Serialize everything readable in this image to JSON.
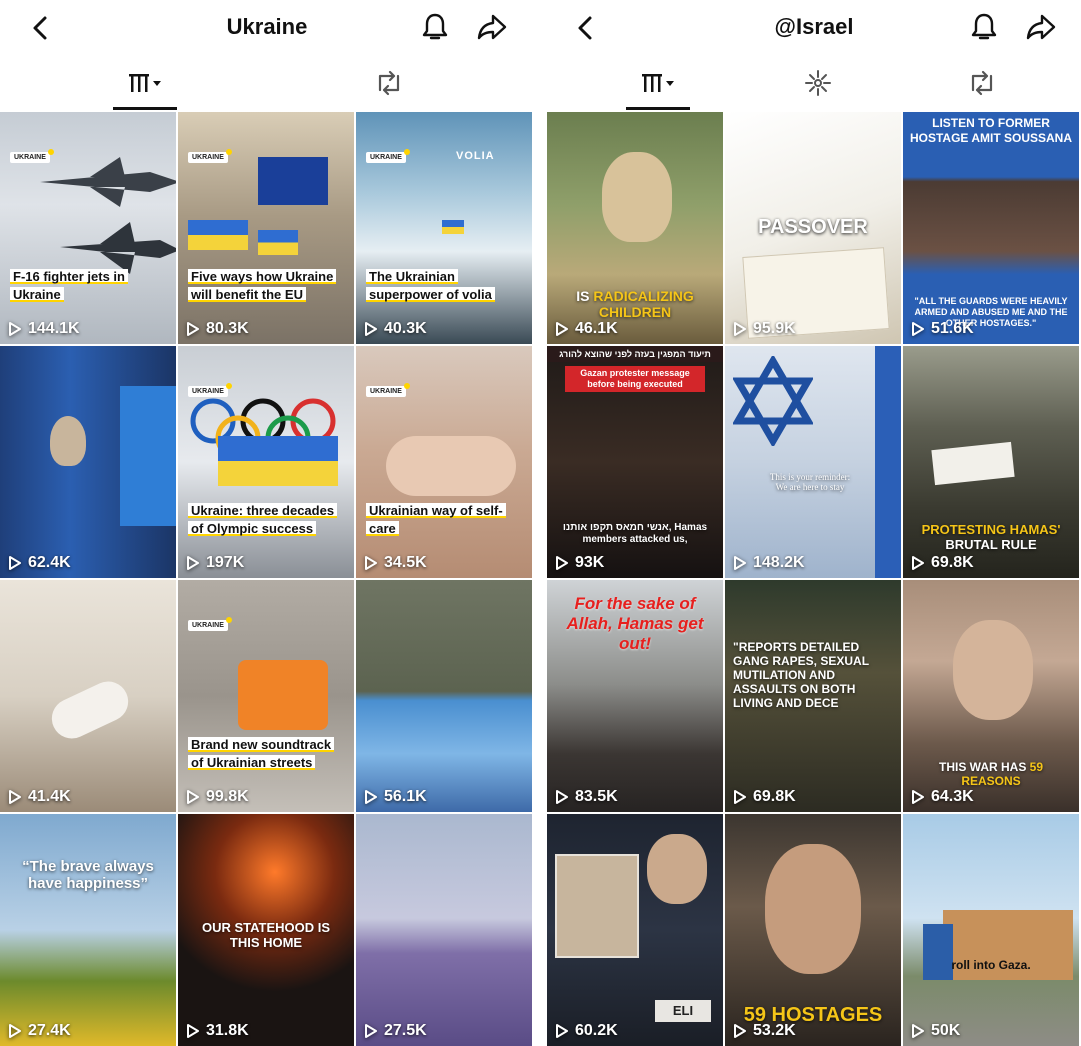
{
  "left": {
    "title": "Ukraine",
    "tiles": [
      {
        "views": "144.1K",
        "logo": "UKRAINE",
        "caption": "F-16 fighter jets in Ukraine"
      },
      {
        "views": "80.3K",
        "logo": "UKRAINE",
        "caption": "Five ways how Ukraine will benefit the EU"
      },
      {
        "views": "40.3K",
        "logo": "UKRAINE",
        "brand": "VOLIA",
        "caption": "The Ukrainian superpower of volia"
      },
      {
        "views": "62.4K"
      },
      {
        "views": "197K",
        "logo": "UKRAINE",
        "caption": "Ukraine: three decades of Olympic success"
      },
      {
        "views": "34.5K",
        "logo": "UKRAINE",
        "caption": "Ukrainian way of self-care"
      },
      {
        "views": "41.4K"
      },
      {
        "views": "99.8K",
        "logo": "UKRAINE",
        "caption": "Brand new soundtrack of Ukrainian streets"
      },
      {
        "views": "56.1K"
      },
      {
        "views": "27.4K",
        "overlay": "“The brave always have happiness”"
      },
      {
        "views": "31.8K",
        "overlay": "OUR STATEHOOD IS THIS HOME"
      },
      {
        "views": "27.5K"
      }
    ]
  },
  "right": {
    "title": "@Israel",
    "tiles": [
      {
        "views": "46.1K",
        "overlay_plain": "IS ",
        "overlay_accent": "RADICALIZING CHILDREN"
      },
      {
        "views": "95.9K",
        "overlay": "PASSOVER"
      },
      {
        "views": "51.6K",
        "top_text": "LISTEN TO FORMER HOSTAGE AMIT SOUSSANA",
        "bottom_text": "\"ALL THE GUARDS WERE HEAVILY ARMED AND ABUSED ME AND THE OTHER HOSTAGES.\""
      },
      {
        "views": "93K",
        "top_text": "תיעוד המפגין בעזה לפני שהוצא להורג",
        "sub_text": "Gazan protester message before being executed",
        "overlay": "אנשי חמאס תקפו אותנו, Hamas members attacked us,"
      },
      {
        "views": "148.2K",
        "overlay": "This is your reminder: We are here to stay"
      },
      {
        "views": "69.8K",
        "overlay_accent": "PROTESTING HAMAS'",
        "overlay_plain": " BRUTAL RULE"
      },
      {
        "views": "83.5K",
        "overlay": "For the sake of Allah, Hamas get out!"
      },
      {
        "views": "69.8K",
        "overlay": "\"REPORTS DETAILED GANG RAPES, SEXUAL MUTILATION AND ASSAULTS ON BOTH LIVING AND DECE"
      },
      {
        "views": "64.3K",
        "overlay_plain": "THIS WAR HAS ",
        "overlay_accent": "59 REASONS"
      },
      {
        "views": "60.2K",
        "overlay": "ELI"
      },
      {
        "views": "53.2K",
        "overlay": "59 HOSTAGES"
      },
      {
        "views": "50K",
        "overlay": "roll into Gaza."
      }
    ]
  },
  "icons": {
    "back": "chevron-left-icon",
    "bell": "bell-icon",
    "share": "share-arrow-icon",
    "grid": "grid-sort-icon",
    "repost": "repost-icon",
    "sparkle": "sparkle-effects-icon",
    "play": "play-icon"
  }
}
